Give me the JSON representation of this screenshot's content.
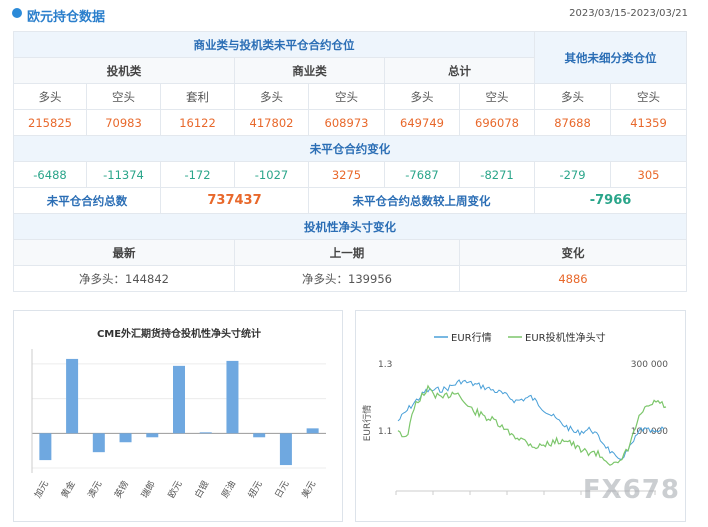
{
  "header": {
    "title": "欧元持仓数据",
    "range": "2023/03/15-2023/03/21"
  },
  "table": {
    "group_title": "商业类与投机类未平仓合约仓位",
    "other_title": "其他未细分类仓位",
    "speculative": "投机类",
    "commercial": "商业类",
    "total": "总计",
    "long": "多头",
    "short": "空头",
    "spread": "套利",
    "positions": [
      "215825",
      "70983",
      "16122",
      "417802",
      "608973",
      "649749",
      "696078",
      "87688",
      "41359"
    ],
    "change_title": "未平仓合约变化",
    "changes": [
      "-6488",
      "-11374",
      "-172",
      "-1027",
      "3275",
      "-7687",
      "-8271",
      "-279",
      "305"
    ],
    "oi_total_label": "未平仓合约总数",
    "oi_total": "737437",
    "oi_change_label": "未平仓合约总数较上周变化",
    "oi_change": "-7966",
    "net_title": "投机性净头寸变化",
    "latest": "最新",
    "previous": "上一期",
    "change": "变化",
    "net_latest": "净多头：144842",
    "net_previous": "净多头：139956",
    "net_change": "4886"
  },
  "chart_data": [
    {
      "type": "bar",
      "title": "CME外汇期货持仓投机性净头寸统计",
      "categories": [
        "加元",
        "黄金",
        "澳元",
        "英镑",
        "瑞郎",
        "欧元",
        "白银",
        "原油",
        "纽元",
        "日元",
        "美元"
      ],
      "values": [
        -27,
        75,
        -19,
        -9,
        -4,
        68,
        1,
        73,
        -4,
        -32,
        5
      ],
      "colors": {
        "bar": "#6fa8e0",
        "axis": "#cccccc"
      }
    },
    {
      "type": "line",
      "legend": [
        "EUR行情",
        "EUR投机性净头寸"
      ],
      "ylabel": "EUR行情",
      "left_ticks": [
        "1.3",
        "1.1"
      ],
      "right_ticks": [
        "300 000",
        "100 000"
      ],
      "colors": {
        "price": "#4aa0d8",
        "position": "#7cc66b"
      }
    }
  ],
  "watermark": "FX678",
  "clip": "一 ● 黑 ▲ 名色 ●   三"
}
